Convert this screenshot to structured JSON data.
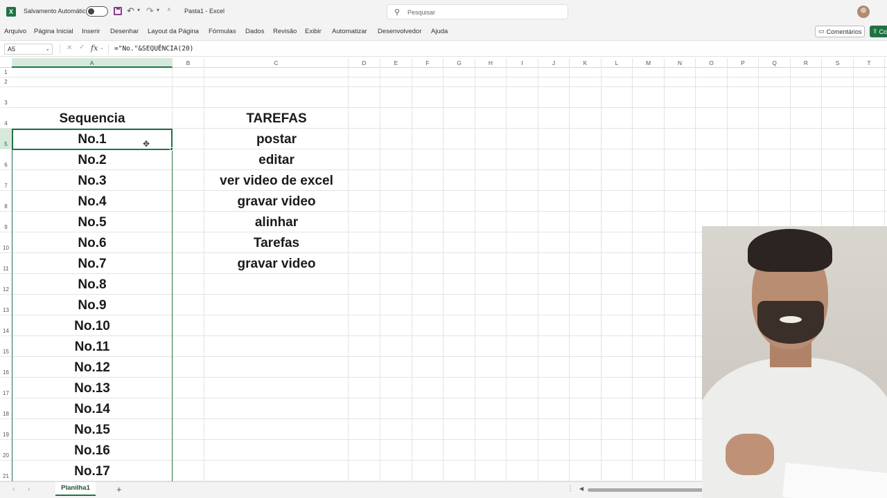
{
  "app": {
    "logo_letter": "X",
    "autosave_label": "Salvamento Automático",
    "doc_title": "Pasta1 - Excel",
    "search_placeholder": "Pesquisar",
    "accent_color": "#1f7244"
  },
  "ribbon": {
    "tabs": [
      "Arquivo",
      "Página Inicial",
      "Inserir",
      "Desenhar",
      "Layout da Página",
      "Fórmulas",
      "Dados",
      "Revisão",
      "Exibir",
      "Automatizar",
      "Desenvolvedor",
      "Ajuda"
    ],
    "comments_label": "Comentários",
    "share_label": "Co"
  },
  "formula_bar": {
    "name_box": "A5",
    "formula": "=\"No.\"&SEQUÊNCIA(20)"
  },
  "grid": {
    "columns": [
      "A",
      "B",
      "C",
      "D",
      "E",
      "F",
      "G",
      "H",
      "I",
      "J",
      "K",
      "L",
      "M",
      "N",
      "O",
      "P",
      "Q",
      "R",
      "S",
      "T"
    ],
    "rows": [
      "1",
      "2",
      "3",
      "4",
      "5",
      "6",
      "7",
      "8",
      "9",
      "10",
      "11",
      "12",
      "13",
      "14",
      "15",
      "16",
      "17",
      "18",
      "19",
      "20",
      "21"
    ],
    "selected_column": "A",
    "active_cell": "A5",
    "column_a": [
      "",
      "",
      "",
      "Sequencia",
      "No.1",
      "No.2",
      "No.3",
      "No.4",
      "No.5",
      "No.6",
      "No.7",
      "No.8",
      "No.9",
      "No.10",
      "No.11",
      "No.12",
      "No.13",
      "No.14",
      "No.15",
      "No.16",
      "No.17"
    ],
    "column_c": [
      "",
      "",
      "",
      "TAREFAS",
      "postar",
      "editar",
      "ver video de excel",
      "gravar video",
      "alinhar",
      "Tarefas",
      "gravar video",
      "",
      "",
      "",
      "",
      "",
      "",
      "",
      "",
      "",
      ""
    ]
  },
  "sheets": {
    "tabs": [
      "Planilha1"
    ],
    "active": "Planilha1"
  }
}
